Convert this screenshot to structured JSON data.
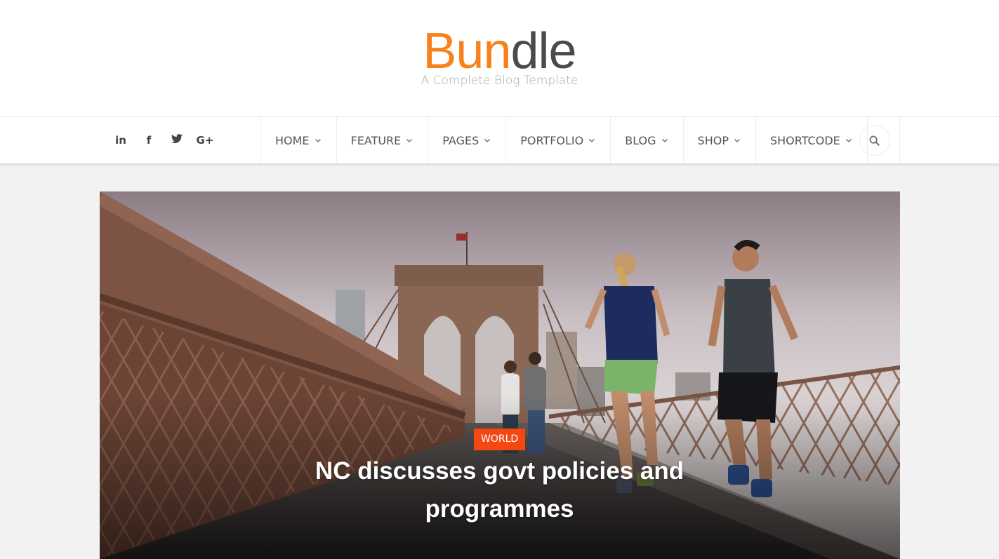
{
  "site": {
    "logo_part1": "Bun",
    "logo_part2": "dle",
    "tagline": "A Complete Blog Template"
  },
  "social": [
    {
      "label": "in",
      "icon": "linkedin-icon"
    },
    {
      "label": "f",
      "icon": "facebook-icon"
    },
    {
      "label": "t",
      "icon": "twitter-icon"
    },
    {
      "label": "G+",
      "icon": "google-plus-icon"
    }
  ],
  "nav": {
    "items": [
      {
        "label": "HOME"
      },
      {
        "label": "FEATURE"
      },
      {
        "label": "PAGES"
      },
      {
        "label": "PORTFOLIO"
      },
      {
        "label": "BLOG"
      },
      {
        "label": "SHOP"
      },
      {
        "label": "SHORTCODE"
      }
    ],
    "search_icon": "search-icon"
  },
  "hero": {
    "category": "WORLD",
    "title": "NC discusses govt policies and programmes"
  },
  "colors": {
    "accent": "#f7821b",
    "badge": "#f44812",
    "text_dark": "#4a4a4a"
  }
}
